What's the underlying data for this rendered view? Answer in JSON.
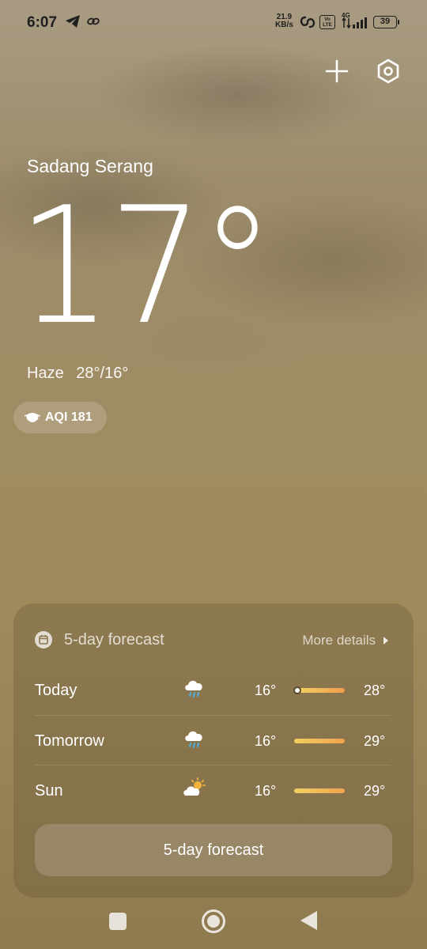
{
  "status_bar": {
    "time": "6:07",
    "net_speed_value": "21.9",
    "net_speed_unit": "KB/s",
    "volte_line1": "Vo",
    "volte_line2": "LTE",
    "network": "4G",
    "battery": "39",
    "icons": [
      "telegram-icon",
      "link-icon",
      "hotspot-icon",
      "signal-icon"
    ]
  },
  "actions": {
    "add_icon": "plus-icon",
    "settings_icon": "hexagon-settings-icon"
  },
  "location": "Sadang Serang",
  "current": {
    "temp": "17°",
    "condition": "Haze",
    "range": "28°/16°",
    "aqi": "AQI 181"
  },
  "forecast": {
    "title": "5-day forecast",
    "more": "More details",
    "days": [
      {
        "day": "Today",
        "icon": "rain-cloud-icon",
        "low": "16°",
        "high": "28°",
        "current_marker": true
      },
      {
        "day": "Tomorrow",
        "icon": "rain-cloud-icon",
        "low": "16°",
        "high": "29°"
      },
      {
        "day": "Sun",
        "icon": "partly-sunny-icon",
        "low": "16°",
        "high": "29°"
      }
    ],
    "button": "5-day forecast"
  },
  "colors": {
    "bar_start": "#f0d060",
    "bar_end": "#f0a250"
  }
}
